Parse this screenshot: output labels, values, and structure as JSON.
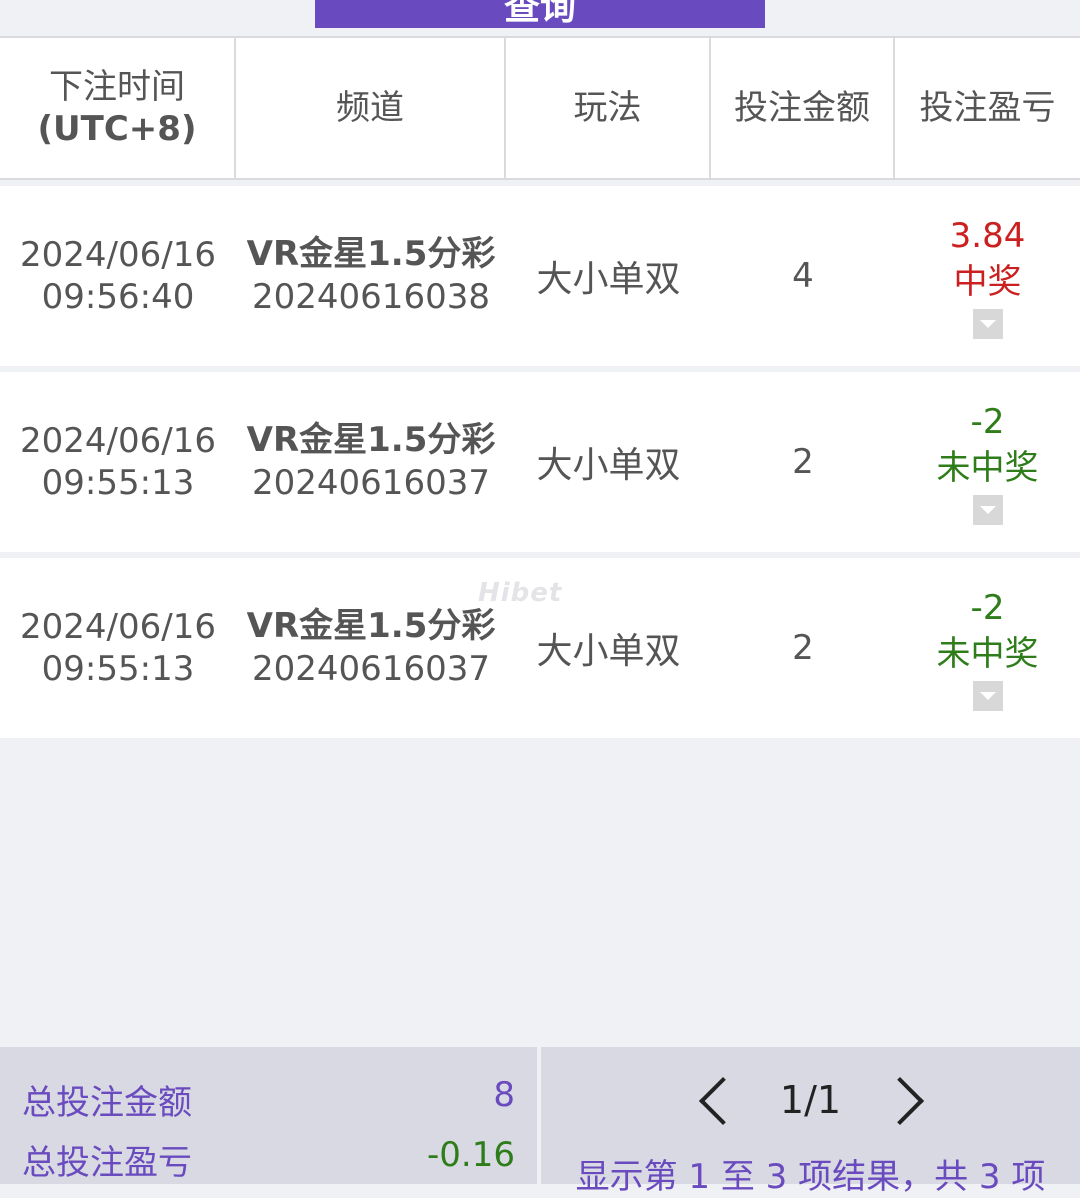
{
  "top_button": {
    "label": "查询"
  },
  "table": {
    "headers": {
      "time_line1": "下注时间",
      "time_line2": "(UTC+8)",
      "channel": "频道",
      "play": "玩法",
      "amount": "投注金额",
      "profit": "投注盈亏"
    },
    "rows": [
      {
        "date": "2024/06/16",
        "time": "09:56:40",
        "channel": "VR金星1.5分彩",
        "issue": "20240616038",
        "play": "大小单双",
        "amount": "4",
        "profit": "3.84",
        "status": "中奖",
        "result": "win"
      },
      {
        "date": "2024/06/16",
        "time": "09:55:13",
        "channel": "VR金星1.5分彩",
        "issue": "20240616037",
        "play": "大小单双",
        "amount": "2",
        "profit": "-2",
        "status": "未中奖",
        "result": "lose"
      },
      {
        "date": "2024/06/16",
        "time": "09:55:13",
        "channel": "VR金星1.5分彩",
        "issue": "20240616037",
        "play": "大小单双",
        "amount": "2",
        "profit": "-2",
        "status": "未中奖",
        "result": "lose"
      }
    ]
  },
  "watermark": "Hibet",
  "summary": {
    "total_amount_label": "总投注金额",
    "total_amount_value": "8",
    "total_profit_label": "总投注盈亏",
    "total_profit_value": "-0.16"
  },
  "pager": {
    "page": "1/1",
    "results_text": "显示第 1 至 3 项结果，共 3 项"
  },
  "colors": {
    "accent": "#6a4bbf",
    "win": "#cc1f1f",
    "lose": "#2e7d1a"
  },
  "icons": [
    "chevron-left-icon",
    "chevron-right-icon",
    "expand-toggle-icon"
  ]
}
